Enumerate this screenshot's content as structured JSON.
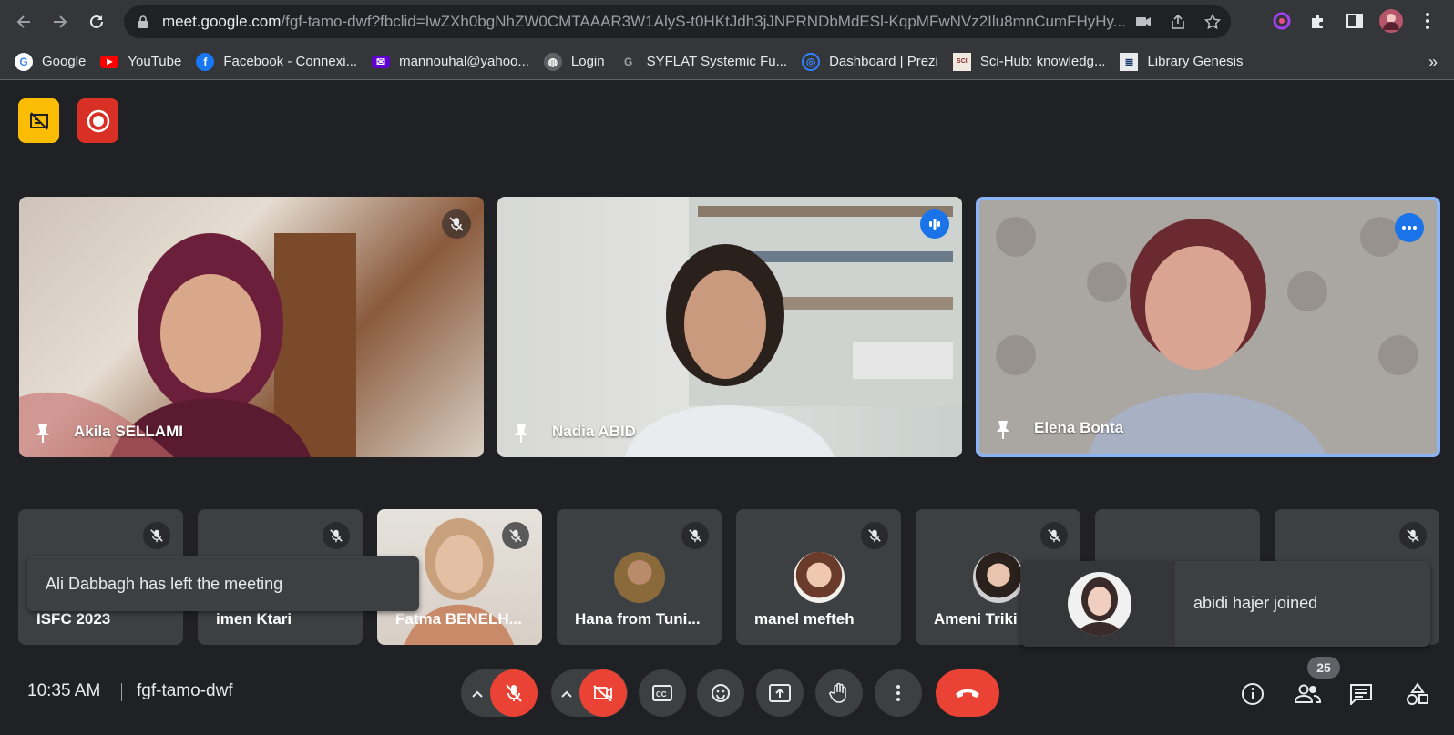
{
  "browser": {
    "url_host": "meet.google.com",
    "url_path": "/fgf-tamo-dwf?fbclid=IwZXh0bgNhZW0CMTAAAR3W1AlyS-t0HKtJdh3jJNPRNDbMdESl-KqpMFwNVz2Ilu8mnCumFHyHy...",
    "bookmarks": [
      {
        "label": "Google",
        "icon": "google-icon",
        "color": "#4285f4"
      },
      {
        "label": "YouTube",
        "icon": "youtube-icon",
        "color": "#ff0000"
      },
      {
        "label": "Facebook - Connexi...",
        "icon": "facebook-icon",
        "color": "#1877f2"
      },
      {
        "label": "mannouhal@yahoo...",
        "icon": "yahoo-icon",
        "color": "#6001d2"
      },
      {
        "label": "Login",
        "icon": "globe-icon",
        "color": "#5f6368"
      },
      {
        "label": "SYFLAT Systemic Fu...",
        "icon": "syflat-icon",
        "color": "#35363a"
      },
      {
        "label": "Dashboard | Prezi",
        "icon": "prezi-icon",
        "color": "#3181ff"
      },
      {
        "label": "Sci-Hub: knowledg...",
        "icon": "scihub-icon",
        "color": "#8b2a2a"
      },
      {
        "label": "Library Genesis",
        "icon": "libgen-icon",
        "color": "#e8eaed"
      }
    ],
    "bookmarks_more": "»"
  },
  "meet": {
    "main_tiles": [
      {
        "name": "Akila SELLAMI",
        "status": "muted"
      },
      {
        "name": "Nadia ABID",
        "status": "speaking"
      },
      {
        "name": "Elena Bonta",
        "status": "more-options"
      }
    ],
    "small_tiles": [
      {
        "name": "ISFC 2023"
      },
      {
        "name": "imen Ktari"
      },
      {
        "name": "Fatma BENELH..."
      },
      {
        "name": "Hana from Tuni..."
      },
      {
        "name": "manel mefteh"
      },
      {
        "name": "Ameni Triki"
      },
      {
        "name": ""
      },
      {
        "name": ""
      }
    ],
    "toast_left": "Ali Dabbagh has left the meeting",
    "toast_join": "abidi hajer joined",
    "time": "10:35 AM",
    "meeting_code": "fgf-tamo-dwf",
    "participant_count": "25",
    "colors": {
      "accent_red": "#ea4335",
      "speaking_blue": "#1a73e8",
      "badge_yellow": "#fbbc04"
    }
  }
}
